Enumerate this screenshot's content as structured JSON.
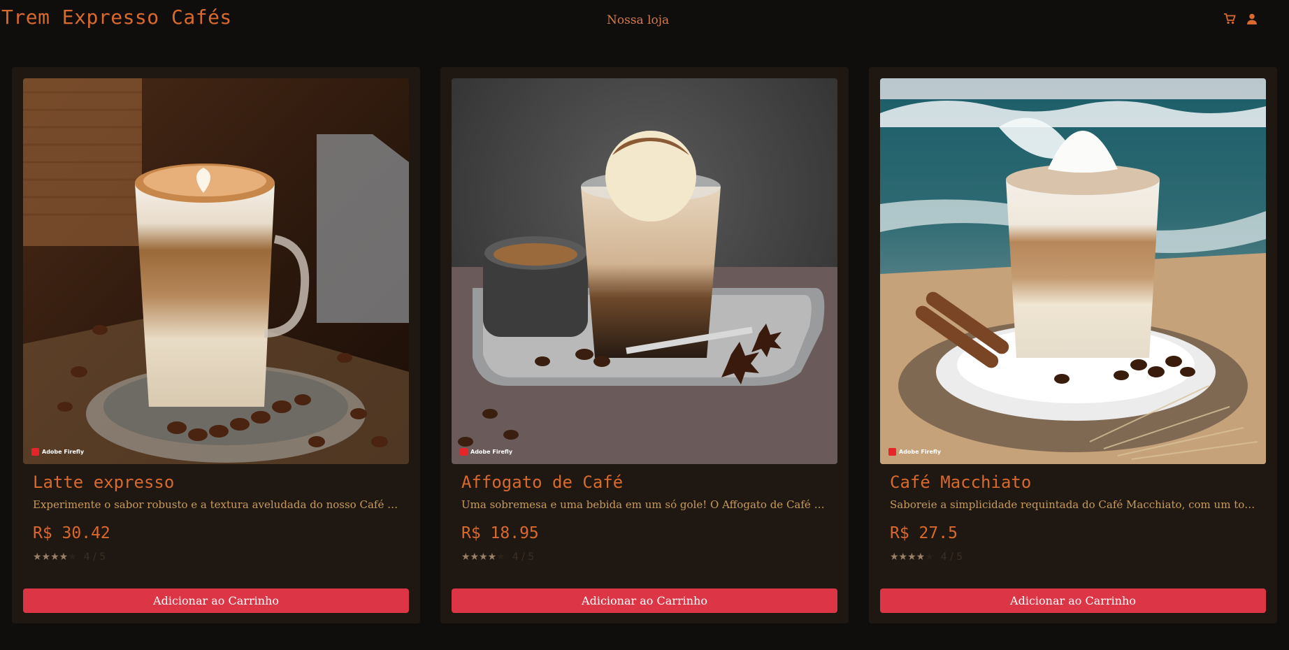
{
  "header": {
    "brand": "Trem Expresso Cafés",
    "nav_link": "Nossa loja",
    "cart_icon": "cart-icon",
    "user_icon": "user-icon"
  },
  "accent": "#d9692c",
  "button_color": "#dc3545",
  "products": [
    {
      "image_badge": "Adobe Firefly",
      "title": "Latte expresso",
      "description": "Experimente o sabor robusto e a textura aveludada do nosso Café L...",
      "price": "R$ 30.42",
      "rating": 4,
      "rating_text": "4 / 5",
      "button": "Adicionar ao Carrinho"
    },
    {
      "image_badge": "Adobe Firefly",
      "title": "Affogato de Café",
      "description": "Uma sobremesa e uma bebida em um só gole! O Affogato de Café co...",
      "price": "R$ 18.95",
      "rating": 4,
      "rating_text": "4 / 5",
      "button": "Adicionar ao Carrinho"
    },
    {
      "image_badge": "Adobe Firefly",
      "title": "Café Macchiato",
      "description": "Saboreie a simplicidade requintada do Café Macchiato, com um toq...",
      "price": "R$ 27.5",
      "rating": 4,
      "rating_text": "4 / 5",
      "button": "Adicionar ao Carrinho"
    }
  ]
}
